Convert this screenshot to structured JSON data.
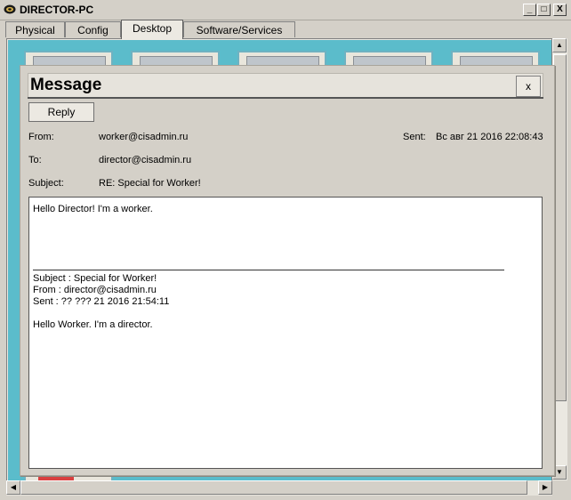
{
  "window": {
    "title": "DIRECTOR-PC",
    "controls": {
      "minimize": "_",
      "maximize": "□",
      "close": "X"
    }
  },
  "tabs": [
    {
      "label": "Physical"
    },
    {
      "label": "Config"
    },
    {
      "label": "Desktop",
      "active": true
    },
    {
      "label": "Software/Services"
    }
  ],
  "message": {
    "title": "Message",
    "close_label": "x",
    "reply_label": "Reply",
    "from_label": "From:",
    "from_value": "worker@cisadmin.ru",
    "sent_label": "Sent:",
    "sent_value": "Вс авг 21 2016 22:08:43",
    "to_label": "To:",
    "to_value": "director@cisadmin.ru",
    "subject_label": "Subject:",
    "subject_value": "RE: Special for Worker!",
    "body": {
      "line1": "Hello Director! I'm a worker.",
      "quoted_subject": "Subject : Special for Worker!",
      "quoted_from": "From : director@cisadmin.ru",
      "quoted_sent": "Sent : ?? ??? 21 2016 21:54:11",
      "quoted_text": "Hello Worker. I'm a director."
    }
  },
  "colors": {
    "desktop_bg": "#5bbccb",
    "dialog_bg": "#d4d0c8"
  },
  "icons": [
    "app-logo-icon",
    "scroll-left-icon",
    "scroll-right-icon",
    "scroll-up-icon",
    "scroll-down-icon"
  ]
}
